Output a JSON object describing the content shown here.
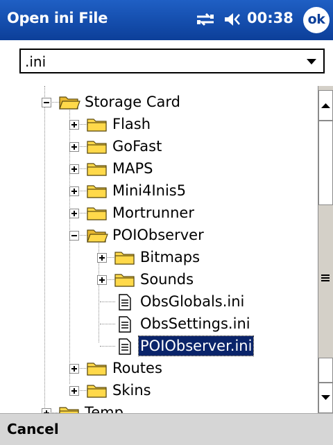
{
  "titlebar": {
    "title": "Open ini File",
    "clock": "00:38",
    "ok_label": "ok",
    "connectivity_icon": "connectivity-icon",
    "speaker_icon": "speaker-icon"
  },
  "filter": {
    "selected": ".ini",
    "icon": "chevron-down-icon"
  },
  "tree": {
    "items": [
      {
        "label": "Storage Card",
        "type": "folder-open",
        "depth": 0,
        "expanded": true
      },
      {
        "label": "Flash",
        "type": "folder",
        "depth": 1
      },
      {
        "label": "GoFast",
        "type": "folder",
        "depth": 1
      },
      {
        "label": "MAPS",
        "type": "folder",
        "depth": 1
      },
      {
        "label": "Mini4Inis5",
        "type": "folder",
        "depth": 1
      },
      {
        "label": "Mortrunner",
        "type": "folder",
        "depth": 1
      },
      {
        "label": "POIObserver",
        "type": "folder-open",
        "depth": 1,
        "expanded": true
      },
      {
        "label": "Bitmaps",
        "type": "folder",
        "depth": 2
      },
      {
        "label": "Sounds",
        "type": "folder",
        "depth": 2
      },
      {
        "label": "ObsGlobals.ini",
        "type": "file",
        "depth": 2
      },
      {
        "label": "ObsSettings.ini",
        "type": "file",
        "depth": 2
      },
      {
        "label": "POIObserver.ini",
        "type": "file",
        "depth": 2,
        "selected": true
      },
      {
        "label": "Routes",
        "type": "folder",
        "depth": 1
      },
      {
        "label": "Skins",
        "type": "folder",
        "depth": 1
      },
      {
        "label": "Temp",
        "type": "folder",
        "depth": 0
      }
    ]
  },
  "menubar": {
    "left_label": "Cancel"
  },
  "colors": {
    "titlebar": "#0c3f99",
    "selection": "#0a246a",
    "folder": "#ffd94a"
  }
}
